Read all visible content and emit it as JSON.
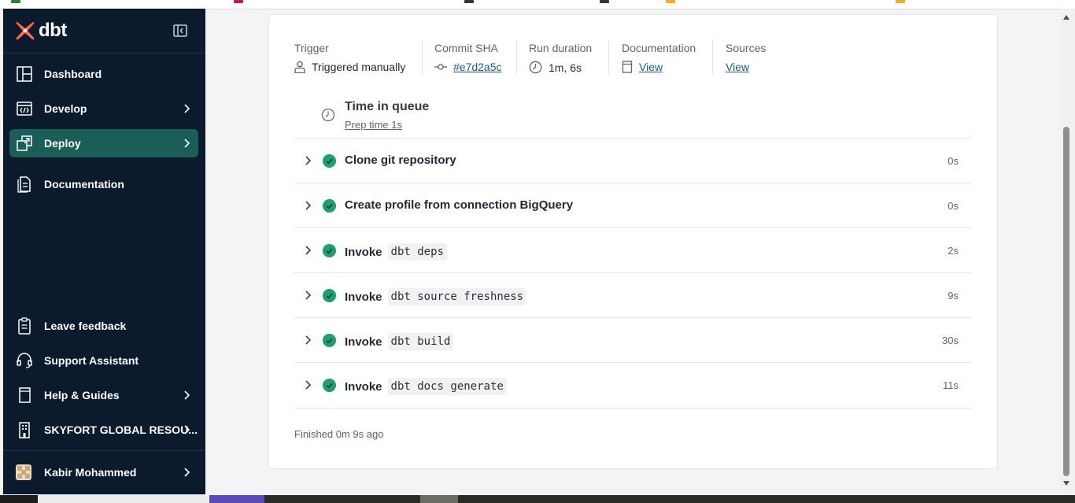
{
  "app": {
    "brand_name": "dbt",
    "brand_color": "#ff694a",
    "sidebar_bg": "#0b1a2c",
    "active_color": "#1b5d57",
    "success_color": "#1f9e6e"
  },
  "sidebar": {
    "top_items": [
      {
        "label": "Dashboard",
        "icon": "dashboard-icon"
      },
      {
        "label": "Develop",
        "icon": "code-icon"
      },
      {
        "label": "Deploy",
        "icon": "deploy-icon",
        "active": true
      },
      {
        "label": "Documentation",
        "icon": "documentation-icon"
      }
    ],
    "bottom_items": [
      {
        "label": "Leave feedback",
        "icon": "clipboard-icon"
      },
      {
        "label": "Support Assistant",
        "icon": "headset-icon"
      },
      {
        "label": "Help & Guides",
        "icon": "book-icon"
      },
      {
        "label": "SKYFORT GLOBAL RESOU...",
        "icon": "building-icon"
      }
    ],
    "user": {
      "name": "Kabir Mohammed"
    }
  },
  "run": {
    "trigger": {
      "label": "Trigger",
      "value": "Triggered manually"
    },
    "commit": {
      "label": "Commit SHA",
      "value": "#e7d2a5c"
    },
    "duration": {
      "label": "Run duration",
      "value": "1m, 6s"
    },
    "documentation": {
      "label": "Documentation",
      "value": "View"
    },
    "sources": {
      "label": "Sources",
      "value": "View"
    },
    "queue": {
      "title": "Time in queue",
      "subtitle": "Prep time 1s"
    },
    "steps": [
      {
        "title": "Clone git repository",
        "command": "",
        "duration": "0s"
      },
      {
        "title": "Create profile from connection BigQuery",
        "command": "",
        "duration": "0s"
      },
      {
        "title": "Invoke",
        "command": "dbt deps",
        "duration": "2s"
      },
      {
        "title": "Invoke",
        "command": "dbt source freshness",
        "duration": "9s"
      },
      {
        "title": "Invoke",
        "command": "dbt build",
        "duration": "30s"
      },
      {
        "title": "Invoke",
        "command": "dbt docs generate",
        "duration": "11s"
      }
    ],
    "finished": "Finished 0m 9s ago"
  }
}
